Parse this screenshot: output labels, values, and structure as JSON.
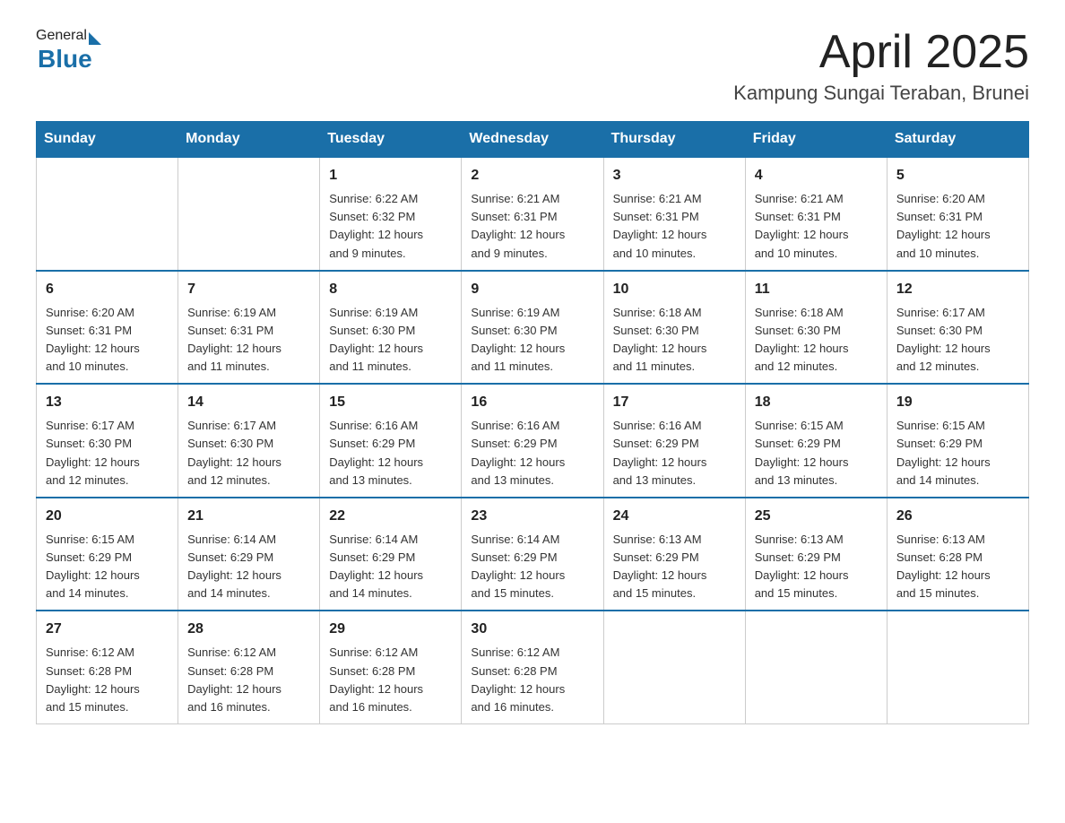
{
  "header": {
    "logo_general": "General",
    "logo_blue": "Blue",
    "month_title": "April 2025",
    "location": "Kampung Sungai Teraban, Brunei"
  },
  "weekdays": [
    "Sunday",
    "Monday",
    "Tuesday",
    "Wednesday",
    "Thursday",
    "Friday",
    "Saturday"
  ],
  "weeks": [
    [
      {
        "day": "",
        "info": ""
      },
      {
        "day": "",
        "info": ""
      },
      {
        "day": "1",
        "info": "Sunrise: 6:22 AM\nSunset: 6:32 PM\nDaylight: 12 hours\nand 9 minutes."
      },
      {
        "day": "2",
        "info": "Sunrise: 6:21 AM\nSunset: 6:31 PM\nDaylight: 12 hours\nand 9 minutes."
      },
      {
        "day": "3",
        "info": "Sunrise: 6:21 AM\nSunset: 6:31 PM\nDaylight: 12 hours\nand 10 minutes."
      },
      {
        "day": "4",
        "info": "Sunrise: 6:21 AM\nSunset: 6:31 PM\nDaylight: 12 hours\nand 10 minutes."
      },
      {
        "day": "5",
        "info": "Sunrise: 6:20 AM\nSunset: 6:31 PM\nDaylight: 12 hours\nand 10 minutes."
      }
    ],
    [
      {
        "day": "6",
        "info": "Sunrise: 6:20 AM\nSunset: 6:31 PM\nDaylight: 12 hours\nand 10 minutes."
      },
      {
        "day": "7",
        "info": "Sunrise: 6:19 AM\nSunset: 6:31 PM\nDaylight: 12 hours\nand 11 minutes."
      },
      {
        "day": "8",
        "info": "Sunrise: 6:19 AM\nSunset: 6:30 PM\nDaylight: 12 hours\nand 11 minutes."
      },
      {
        "day": "9",
        "info": "Sunrise: 6:19 AM\nSunset: 6:30 PM\nDaylight: 12 hours\nand 11 minutes."
      },
      {
        "day": "10",
        "info": "Sunrise: 6:18 AM\nSunset: 6:30 PM\nDaylight: 12 hours\nand 11 minutes."
      },
      {
        "day": "11",
        "info": "Sunrise: 6:18 AM\nSunset: 6:30 PM\nDaylight: 12 hours\nand 12 minutes."
      },
      {
        "day": "12",
        "info": "Sunrise: 6:17 AM\nSunset: 6:30 PM\nDaylight: 12 hours\nand 12 minutes."
      }
    ],
    [
      {
        "day": "13",
        "info": "Sunrise: 6:17 AM\nSunset: 6:30 PM\nDaylight: 12 hours\nand 12 minutes."
      },
      {
        "day": "14",
        "info": "Sunrise: 6:17 AM\nSunset: 6:30 PM\nDaylight: 12 hours\nand 12 minutes."
      },
      {
        "day": "15",
        "info": "Sunrise: 6:16 AM\nSunset: 6:29 PM\nDaylight: 12 hours\nand 13 minutes."
      },
      {
        "day": "16",
        "info": "Sunrise: 6:16 AM\nSunset: 6:29 PM\nDaylight: 12 hours\nand 13 minutes."
      },
      {
        "day": "17",
        "info": "Sunrise: 6:16 AM\nSunset: 6:29 PM\nDaylight: 12 hours\nand 13 minutes."
      },
      {
        "day": "18",
        "info": "Sunrise: 6:15 AM\nSunset: 6:29 PM\nDaylight: 12 hours\nand 13 minutes."
      },
      {
        "day": "19",
        "info": "Sunrise: 6:15 AM\nSunset: 6:29 PM\nDaylight: 12 hours\nand 14 minutes."
      }
    ],
    [
      {
        "day": "20",
        "info": "Sunrise: 6:15 AM\nSunset: 6:29 PM\nDaylight: 12 hours\nand 14 minutes."
      },
      {
        "day": "21",
        "info": "Sunrise: 6:14 AM\nSunset: 6:29 PM\nDaylight: 12 hours\nand 14 minutes."
      },
      {
        "day": "22",
        "info": "Sunrise: 6:14 AM\nSunset: 6:29 PM\nDaylight: 12 hours\nand 14 minutes."
      },
      {
        "day": "23",
        "info": "Sunrise: 6:14 AM\nSunset: 6:29 PM\nDaylight: 12 hours\nand 15 minutes."
      },
      {
        "day": "24",
        "info": "Sunrise: 6:13 AM\nSunset: 6:29 PM\nDaylight: 12 hours\nand 15 minutes."
      },
      {
        "day": "25",
        "info": "Sunrise: 6:13 AM\nSunset: 6:29 PM\nDaylight: 12 hours\nand 15 minutes."
      },
      {
        "day": "26",
        "info": "Sunrise: 6:13 AM\nSunset: 6:28 PM\nDaylight: 12 hours\nand 15 minutes."
      }
    ],
    [
      {
        "day": "27",
        "info": "Sunrise: 6:12 AM\nSunset: 6:28 PM\nDaylight: 12 hours\nand 15 minutes."
      },
      {
        "day": "28",
        "info": "Sunrise: 6:12 AM\nSunset: 6:28 PM\nDaylight: 12 hours\nand 16 minutes."
      },
      {
        "day": "29",
        "info": "Sunrise: 6:12 AM\nSunset: 6:28 PM\nDaylight: 12 hours\nand 16 minutes."
      },
      {
        "day": "30",
        "info": "Sunrise: 6:12 AM\nSunset: 6:28 PM\nDaylight: 12 hours\nand 16 minutes."
      },
      {
        "day": "",
        "info": ""
      },
      {
        "day": "",
        "info": ""
      },
      {
        "day": "",
        "info": ""
      }
    ]
  ]
}
